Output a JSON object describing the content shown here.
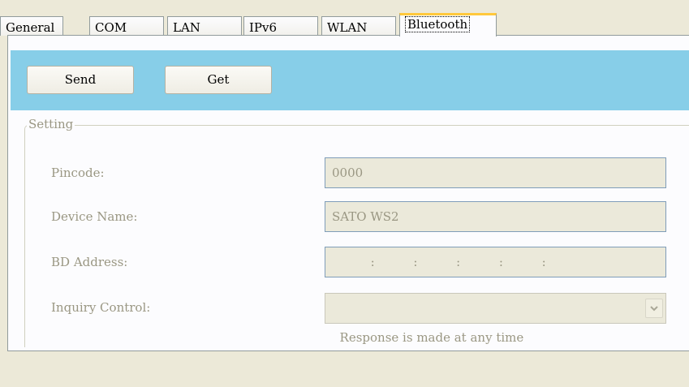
{
  "tabs": [
    {
      "label": "General"
    },
    {
      "label": "COM"
    },
    {
      "label": "LAN"
    },
    {
      "label": "IPv6"
    },
    {
      "label": "WLAN"
    },
    {
      "label": "Bluetooth",
      "active": true
    }
  ],
  "toolbar": {
    "send_label": "Send",
    "get_label": "Get",
    "color": "#87cee8"
  },
  "setting": {
    "legend": "Setting",
    "pincode": {
      "label": "Pincode:",
      "value": "0000"
    },
    "device_name": {
      "label": "Device Name:",
      "value": "SATO WS2"
    },
    "bd_address": {
      "label": "BD Address:",
      "value": "          :          :          :          :          :"
    },
    "inquiry_control": {
      "label": "Inquiry Control:",
      "value": "Response is made at any time",
      "icon": "chevron-down-icon"
    }
  }
}
